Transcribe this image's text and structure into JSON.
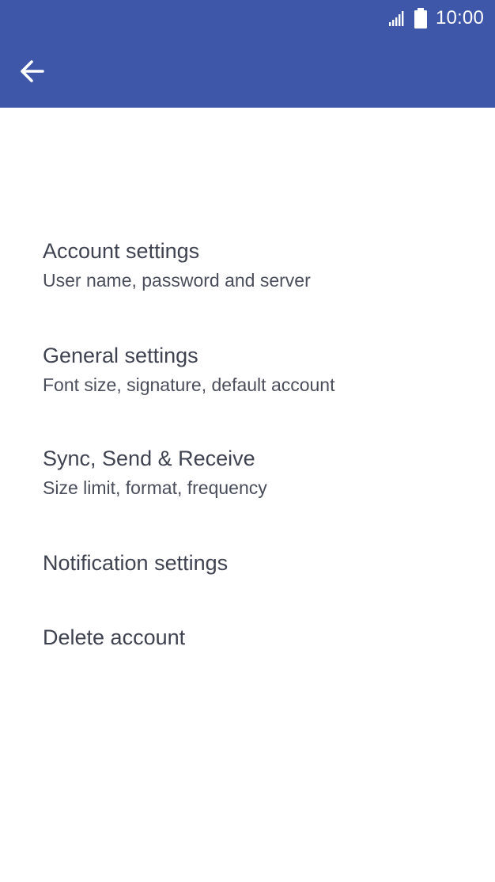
{
  "status_bar": {
    "time": "10:00",
    "signal_icon": "signal-icon",
    "battery_icon": "battery-icon"
  },
  "header": {
    "back_icon": "arrow-back-icon",
    "background_color": "#3f57a8"
  },
  "items": [
    {
      "title": "Account settings",
      "subtitle": "User name, password and server"
    },
    {
      "title": "General settings",
      "subtitle": "Font size, signature, default account"
    },
    {
      "title": "Sync, Send & Receive",
      "subtitle": "Size limit, format, frequency"
    },
    {
      "title": "Notification settings"
    },
    {
      "title": "Delete account"
    }
  ]
}
